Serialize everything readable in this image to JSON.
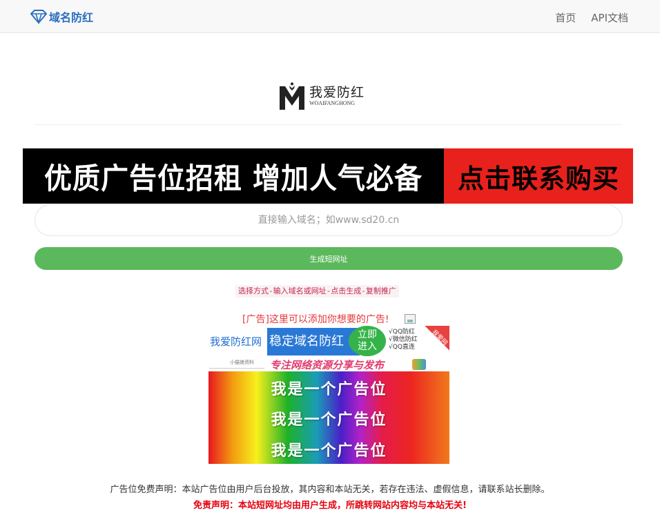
{
  "nav": {
    "brand": "域名防红",
    "links": [
      "首页",
      "API文档"
    ]
  },
  "logo": {
    "cn": "我爱防红",
    "en": "WOAIFANGHONG"
  },
  "banner": {
    "left_text": "优质广告位招租 增加人气必备",
    "right_text": "点击联系购买"
  },
  "form": {
    "input_placeholder": "直接输入域名；如www.sd20.cn",
    "submit_label": "生成短网址"
  },
  "tip": "选择方式-输入域名或网址-点击生成-复制推广",
  "ads": {
    "text_link": "[广告]这里可以添加你想要的广告!",
    "ad1": {
      "brand": "我爱防红网",
      "slogan": "稳定域名防红",
      "cta": [
        "立即",
        "进入"
      ],
      "features": [
        "√QQ防红",
        "√微信防红",
        "√QQ直连"
      ],
      "corner": "我爱网"
    },
    "ad2": {
      "text": "专注网络资源分享与发布",
      "small": "小猫娘资料"
    },
    "ad3": {
      "lines": [
        "我是一个广告位",
        "我是一个广告位",
        "我是一个广告位"
      ]
    }
  },
  "footer": {
    "disclaimer": "广告位免费声明：本站广告位由用户后台投放，其内容和本站无关，若存在违法、虚假信息，请联系站长删除。",
    "notice": "免责声明：本站短网址均由用户生成，所跳转网站内容均与本站无关!"
  },
  "colors": {
    "brand_blue": "#2a6ebf",
    "button_green": "#5cb85c",
    "tip_red": "#c7254e",
    "notice_red": "#e4000f"
  },
  "icons": {
    "brand": "diamond-icon",
    "broken_image": "broken-image-icon"
  }
}
